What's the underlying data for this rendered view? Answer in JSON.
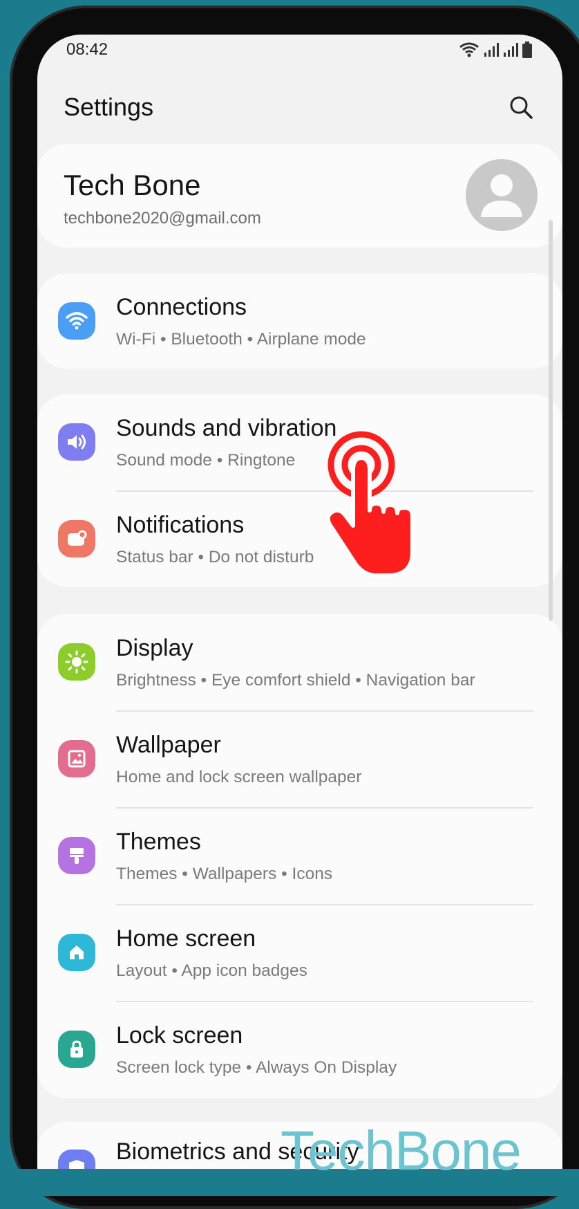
{
  "status_bar": {
    "time": "08:42"
  },
  "header": {
    "title": "Settings"
  },
  "profile": {
    "name": "Tech Bone",
    "email": "techbone2020@gmail.com"
  },
  "items": [
    {
      "title": "Connections",
      "subtitle": "Wi-Fi  •  Bluetooth  •  Airplane mode",
      "icon": "wifi-icon",
      "color": "#4a9ff5"
    },
    {
      "title": "Sounds and vibration",
      "subtitle": "Sound mode  •  Ringtone",
      "icon": "volume-icon",
      "color": "#7f7ef0"
    },
    {
      "title": "Notifications",
      "subtitle": "Status bar  •  Do not disturb",
      "icon": "notification-icon",
      "color": "#ee7766"
    },
    {
      "title": "Display",
      "subtitle": "Brightness  •  Eye comfort shield  •  Navigation bar",
      "icon": "sun-icon",
      "color": "#8ccd2c"
    },
    {
      "title": "Wallpaper",
      "subtitle": "Home and lock screen wallpaper",
      "icon": "image-icon",
      "color": "#e36d8e"
    },
    {
      "title": "Themes",
      "subtitle": "Themes  •  Wallpapers  •  Icons",
      "icon": "paintbrush-icon",
      "color": "#b373e0"
    },
    {
      "title": "Home screen",
      "subtitle": "Layout  •  App icon badges",
      "icon": "home-icon",
      "color": "#2eb8d8"
    },
    {
      "title": "Lock screen",
      "subtitle": "Screen lock type  •  Always On Display",
      "icon": "lock-icon",
      "color": "#2aa791"
    },
    {
      "title": "Biometrics and security",
      "subtitle": "",
      "icon": "shield-icon",
      "color": "#6e7ef0"
    }
  ],
  "watermark": "TechBone",
  "colors": {
    "accent": "#1a7c8c",
    "tap_indicator": "#ff1e1e"
  }
}
